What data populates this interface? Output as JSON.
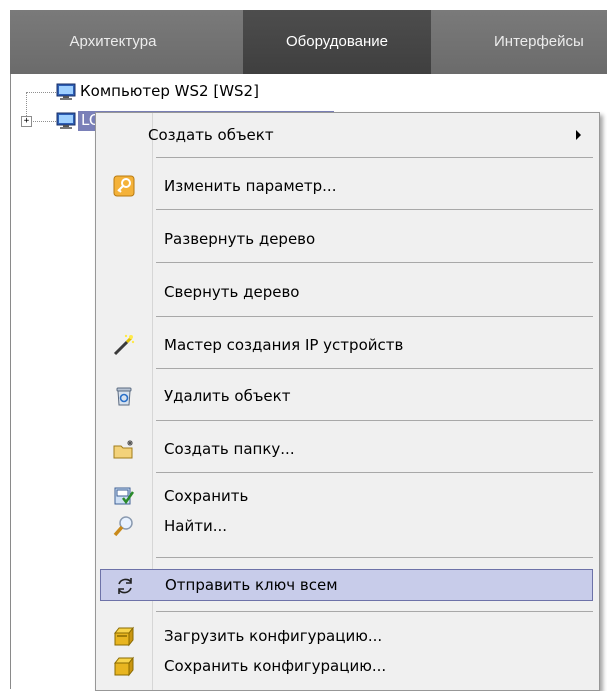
{
  "tabs": [
    {
      "label": "Архитектура",
      "active": false
    },
    {
      "label": "Оборудование",
      "active": true
    },
    {
      "label": "Интерфейсы",
      "active": false
    }
  ],
  "tree": {
    "nodes": [
      {
        "label": "Компьютер WS2 [WS2]",
        "selected": false
      },
      {
        "label": "LO",
        "selected": true
      }
    ],
    "expander_symbol": "+"
  },
  "context_menu": {
    "items": [
      {
        "label": "Создать объект",
        "icon": "none",
        "submenu": true
      },
      {
        "label": "Изменить параметр...",
        "icon": "key-icon"
      },
      {
        "label": "Развернуть дерево",
        "icon": "none"
      },
      {
        "label": "Свернуть дерево",
        "icon": "none"
      },
      {
        "label": "Мастер создания IP устройств",
        "icon": "wand-icon"
      },
      {
        "label": "Удалить объект",
        "icon": "recycle-bin-icon"
      },
      {
        "label": "Создать папку...",
        "icon": "new-folder-icon"
      },
      {
        "label": "Сохранить",
        "icon": "save-icon"
      },
      {
        "label": "Найти...",
        "icon": "magnifier-icon"
      },
      {
        "label": "Отправить ключ всем",
        "icon": "refresh-icon",
        "highlighted": true
      },
      {
        "label": "Загрузить конфигурацию...",
        "icon": "load-config-icon"
      },
      {
        "label": "Сохранить конфигурацию...",
        "icon": "save-config-icon"
      }
    ]
  },
  "colors": {
    "tabbar": "#6f6f6f",
    "active_tab": "#454545",
    "selection": "#7a80b8",
    "menu_bg": "#f0f0f0",
    "menu_highlight": "#c8ccea"
  }
}
